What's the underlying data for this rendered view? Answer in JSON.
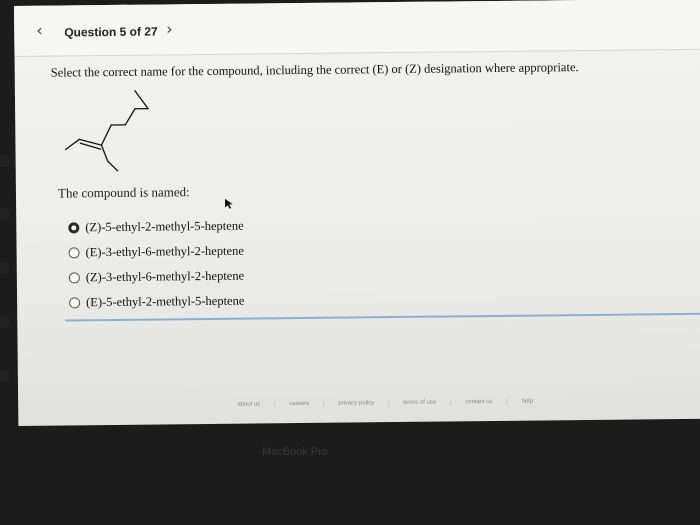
{
  "header": {
    "prev_icon": "chevron-left-icon",
    "question_counter": "Question 5 of 27",
    "next_icon": "chevron-right-icon"
  },
  "question": {
    "prompt": "Select the correct name for the compound, including the correct (E) or (Z) designation where appropriate.",
    "named_label": "The compound is named:",
    "options": [
      {
        "label": "(Z)-5-ethyl-2-methyl-5-heptene",
        "selected": true
      },
      {
        "label": "(E)-3-ethyl-6-methyl-2-heptene",
        "selected": false
      },
      {
        "label": "(Z)-3-ethyl-6-methyl-2-heptene",
        "selected": false
      },
      {
        "label": "(E)-5-ethyl-2-methyl-5-heptene",
        "selected": false
      }
    ]
  },
  "footer": {
    "links": [
      "about us",
      "careers",
      "privacy policy",
      "terms of use",
      "contact us",
      "help"
    ]
  },
  "device": {
    "bezel_label": "MacBook Pro"
  }
}
